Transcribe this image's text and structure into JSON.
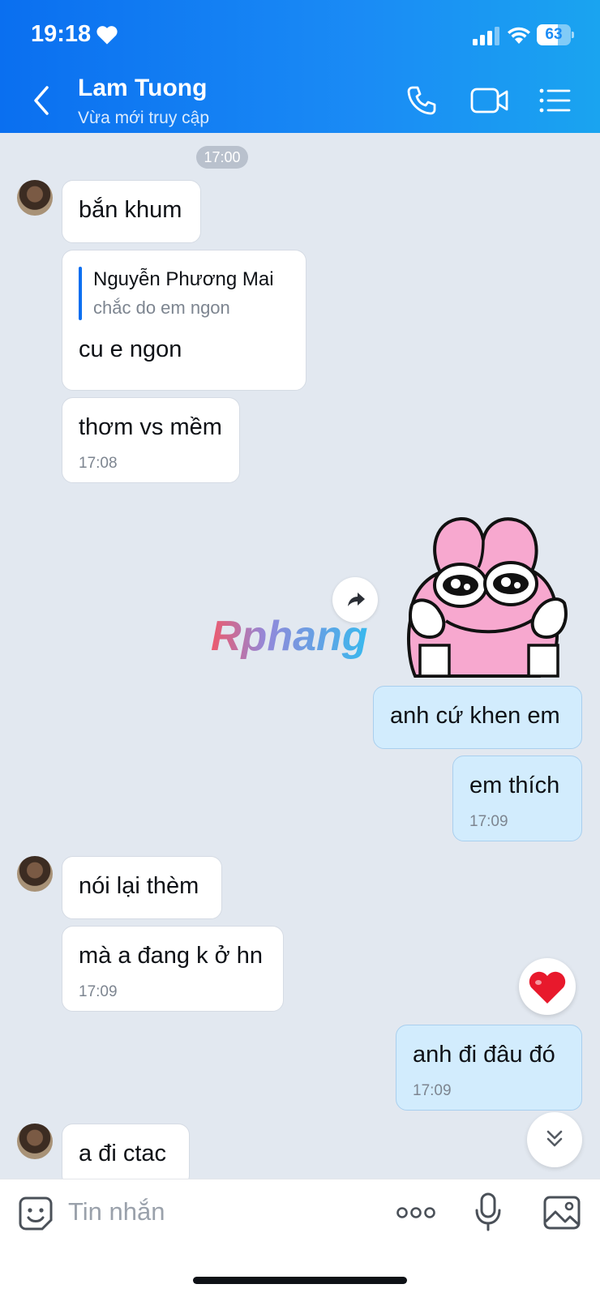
{
  "status_bar": {
    "time": "19:18",
    "battery": "63",
    "battery_level": 0.63
  },
  "header": {
    "contact_name": "Lam Tuong",
    "contact_status": "Vừa mới truy cập"
  },
  "chat": {
    "time_divider": "17:00",
    "messages": [
      {
        "dir": "in",
        "text": "bắn khum"
      },
      {
        "dir": "in",
        "quote_name": "Nguyễn Phương Mai",
        "quote_text": "chắc do em ngon",
        "text": "cu e ngon"
      },
      {
        "dir": "in",
        "text": "thơm vs mềm",
        "time": "17:08"
      },
      {
        "dir": "out",
        "text": "anh cứ khen em"
      },
      {
        "dir": "out",
        "text": "em thích",
        "time": "17:09"
      },
      {
        "dir": "in",
        "text": "nói lại thèm"
      },
      {
        "dir": "in",
        "text": "mà a đang k ở hn",
        "time": "17:09"
      },
      {
        "dir": "out",
        "text": "anh đi đâu đó",
        "time": "17:09"
      },
      {
        "dir": "in",
        "text": "a đi ctac"
      }
    ],
    "watermark": "Rphang"
  },
  "input": {
    "placeholder": "Tin nhắn"
  },
  "colors": {
    "header_start": "#0a6ff0",
    "header_end": "#1aa4f0",
    "chat_bg": "#e2e8f0",
    "bubble_in": "#ffffff",
    "bubble_out": "#d2ecfd",
    "accent": "#0a6ff0"
  },
  "icons": [
    "heart-icon",
    "signal-icon",
    "wifi-icon",
    "battery-icon",
    "back-icon",
    "phone-icon",
    "video-call-icon",
    "menu-list-icon",
    "share-icon",
    "heart-reaction-icon",
    "chevron-double-down-icon",
    "sticker-icon",
    "more-dots-icon",
    "microphone-icon",
    "gallery-icon"
  ]
}
